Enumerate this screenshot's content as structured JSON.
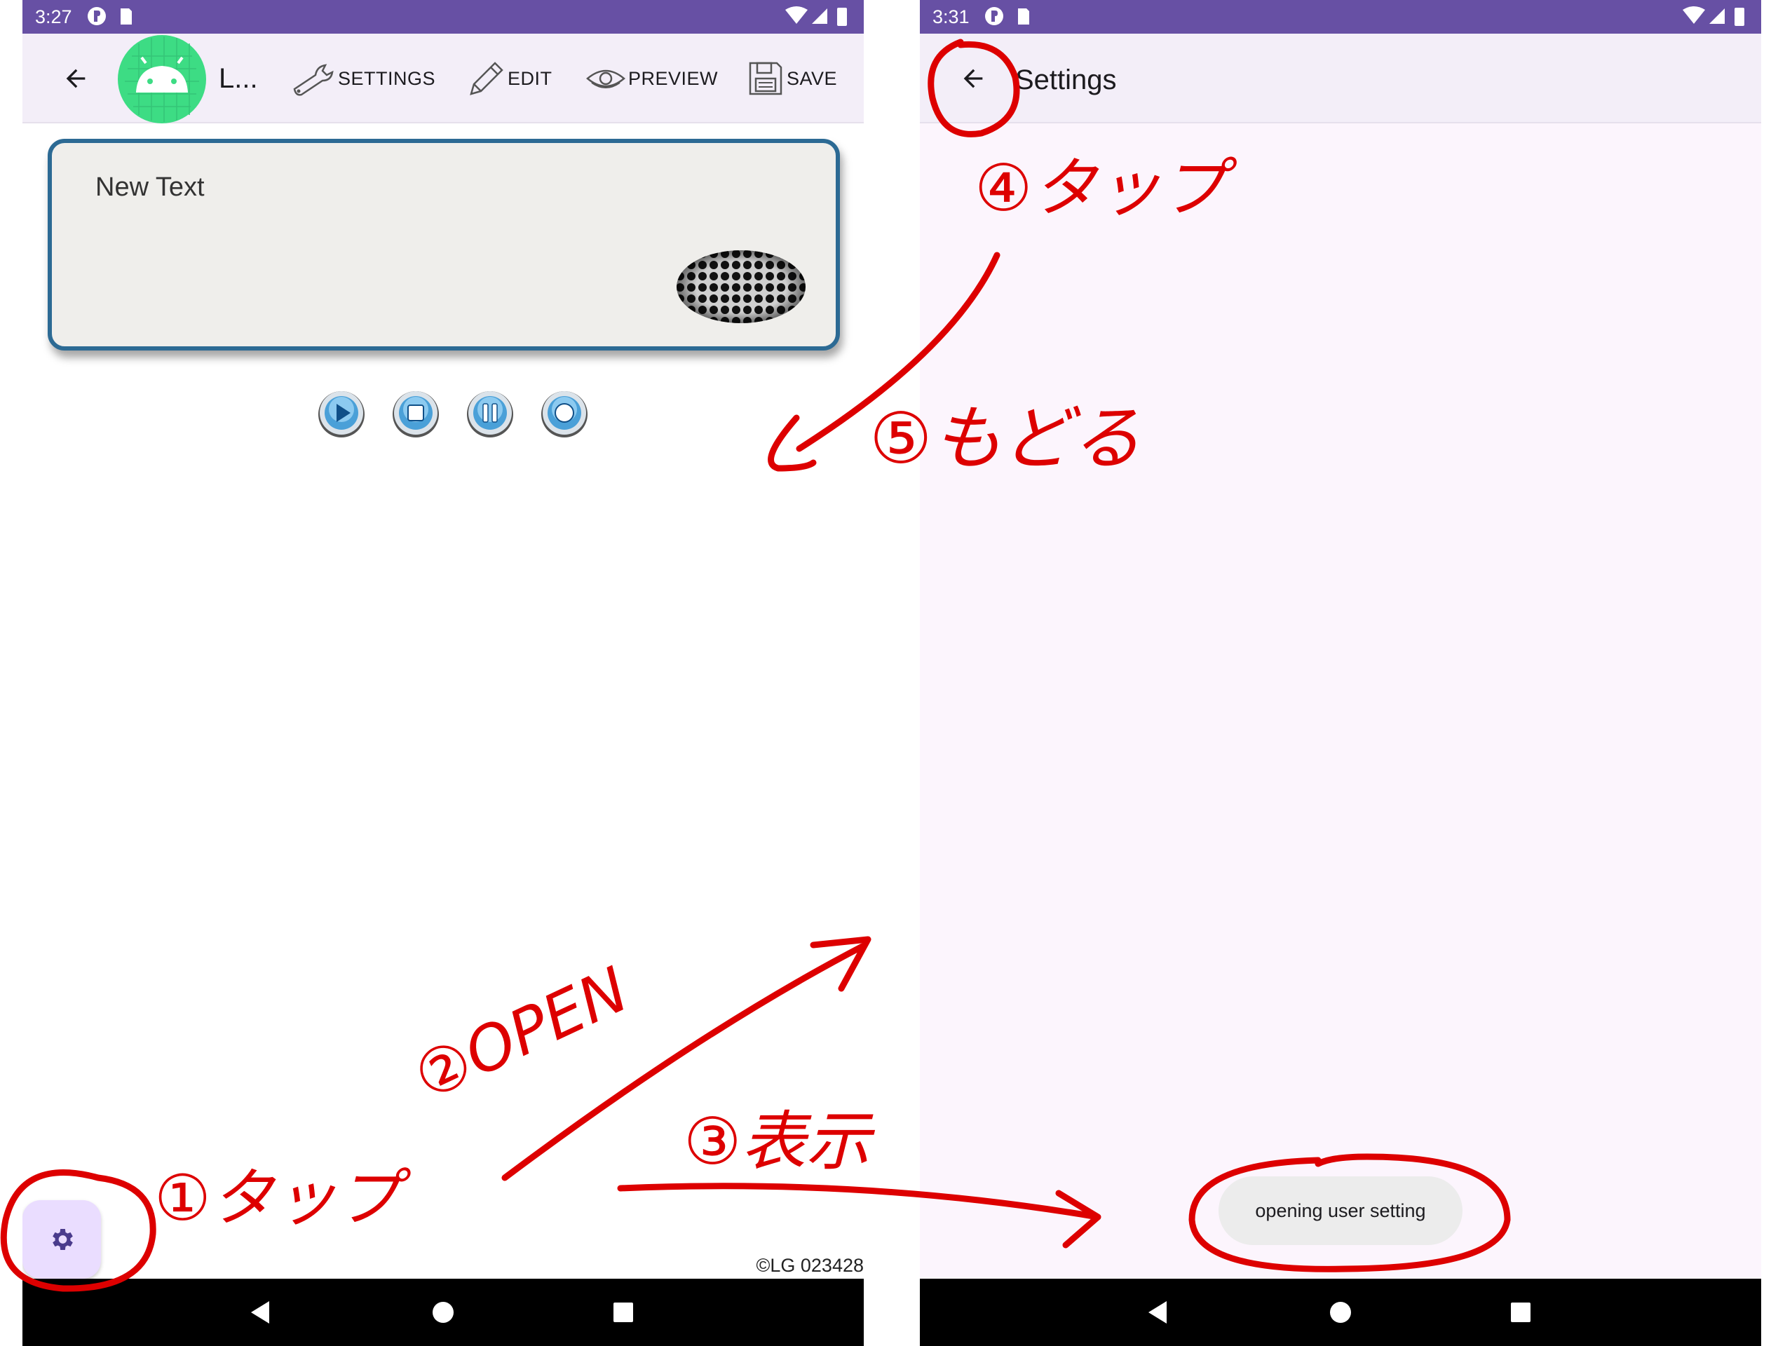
{
  "left_screen": {
    "status_bar": {
      "time": "3:27"
    },
    "app_bar": {
      "back_icon": "arrow-back-icon",
      "app_icon": "android-icon",
      "title": "L...",
      "actions": [
        {
          "label": "SETTINGS",
          "icon": "wrench-icon"
        },
        {
          "label": "EDIT",
          "icon": "pencil-icon"
        },
        {
          "label": "PREVIEW",
          "icon": "eye-icon"
        },
        {
          "label": "SAVE",
          "icon": "floppy-disk-icon"
        }
      ]
    },
    "text_panel": {
      "text": "New Text",
      "image": "speaker-grille-image"
    },
    "media_controls": [
      {
        "name": "play",
        "icon": "play-icon"
      },
      {
        "name": "stop",
        "icon": "stop-icon"
      },
      {
        "name": "pause",
        "icon": "pause-icon"
      },
      {
        "name": "record",
        "icon": "record-icon"
      }
    ],
    "fab": {
      "icon": "gear-icon"
    },
    "copyright": "©LG 023428"
  },
  "right_screen": {
    "status_bar": {
      "time": "3:31"
    },
    "app_bar": {
      "back_icon": "arrow-back-icon",
      "title": "Settings"
    },
    "toast": "opening user setting"
  },
  "annotations": {
    "step1": "①タップ",
    "step2": "②OPEN",
    "step3": "③表示",
    "step4": "④タップ",
    "step5": "⑤もどる"
  },
  "colors": {
    "status_bar": "#6750a4",
    "app_bar": "#f3eef8",
    "panel_border": "#2c6a94",
    "fab": "#eaddff",
    "annotation": "#dd0000"
  }
}
